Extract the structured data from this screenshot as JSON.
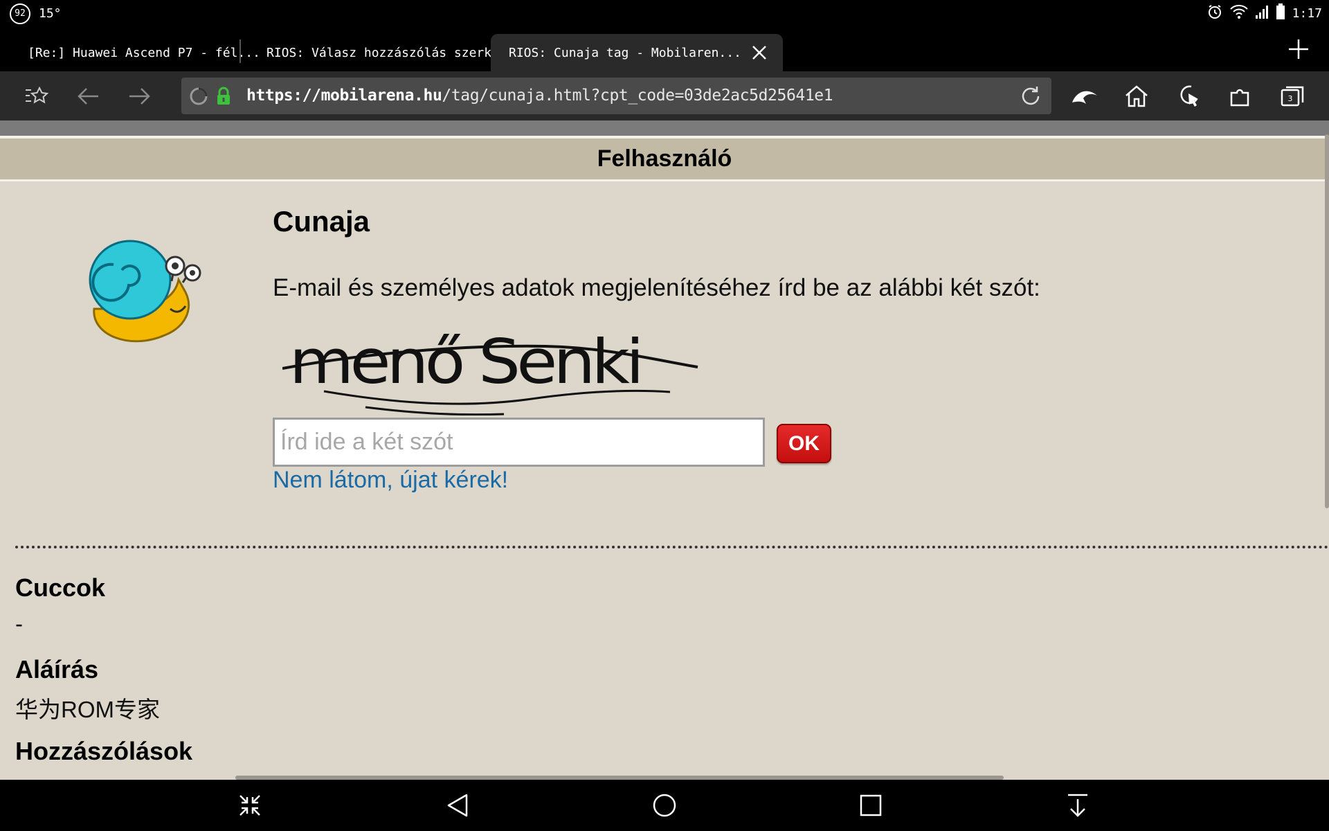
{
  "status_bar": {
    "badge": "92",
    "temperature": "15°",
    "time": "1:17"
  },
  "tabs": [
    {
      "label": "[Re:] Huawei Ascend P7 - fél..."
    },
    {
      "label": "RIOS: Válasz hozzászólás szerk..."
    },
    {
      "label": "RIOS: Cunaja tag - Mobilaren...",
      "active": true
    }
  ],
  "address_bar": {
    "scheme": "https://",
    "host": "mobilarena.hu",
    "path": "/tag/cunaja.html?cpt_code=03de2ac5d25641e1"
  },
  "icons": {
    "toolbar": [
      "bookmarks-icon",
      "back-icon",
      "forward-icon",
      "reload-icon",
      "dolphin-icon",
      "home-icon",
      "gesture-icon",
      "addons-icon",
      "tab-switcher-icon"
    ],
    "nav": [
      "collapse-icon",
      "back-icon",
      "home-icon",
      "recents-icon",
      "download-icon"
    ]
  },
  "tab_count": "3",
  "page": {
    "header": "Felhasználó",
    "user_name": "Cunaja",
    "instructions": "E-mail és személyes adatok megjelenítéséhez írd be az alábbi két szót:",
    "captcha_text": "menő Senki",
    "captcha_placeholder": "Írd ide a két szót",
    "ok_label": "OK",
    "new_captcha_link": "Nem látom, újat kérek!",
    "sections": [
      {
        "title": "Cuccok",
        "value": "-"
      },
      {
        "title": "Aláírás",
        "value": "华为ROM专家"
      },
      {
        "title": "Hozzászólások",
        "value": ""
      }
    ]
  },
  "colors": {
    "page_bg": "#ddd7cb",
    "header_bg": "#c3baa6",
    "link": "#1a6aa5",
    "ok_button": "#d81c1c",
    "avatar_shell": "#2ec8d8",
    "avatar_body": "#f5b800"
  }
}
